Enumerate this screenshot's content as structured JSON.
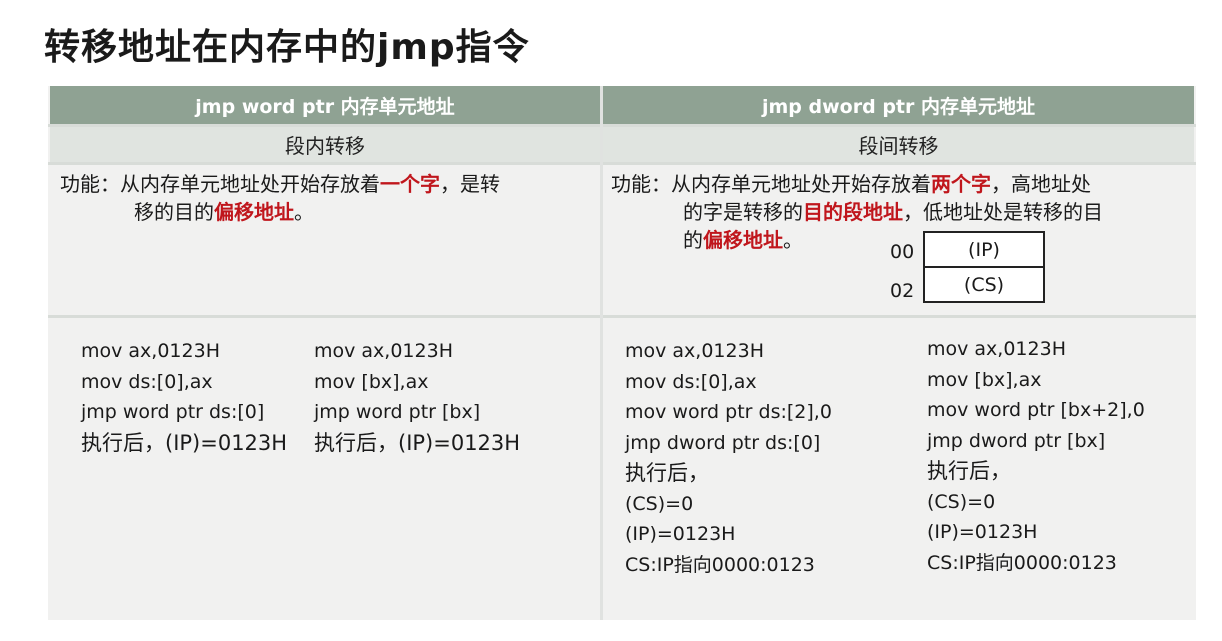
{
  "title": "转移地址在内存中的jmp指令",
  "columns": [
    {
      "header": "jmp word ptr 内存单元地址",
      "subheader": "段内转移",
      "desc_prefix": "功能：从内存单元地址处开始存放着",
      "desc_red1": "一个字",
      "desc_mid": "，是转",
      "desc_line2_a": "移的目的",
      "desc_red2": "偏移地址",
      "desc_line2_b": "。",
      "examples": [
        {
          "lines": [
            "mov ax,0123H",
            "mov ds:[0],ax",
            "jmp word ptr ds:[0]"
          ],
          "result": "执行后，(IP)=0123H"
        },
        {
          "lines": [
            "mov ax,0123H",
            "mov [bx],ax",
            "jmp word ptr [bx]"
          ],
          "result": "执行后，(IP)=0123H"
        }
      ]
    },
    {
      "header": "jmp dword ptr 内存单元地址",
      "subheader": "段间转移",
      "desc_prefix": "功能：从内存单元地址处开始存放着",
      "desc_red1": "两个字",
      "desc_mid": "，高地址处",
      "desc_line2_a": "的字是转移的",
      "desc_red2": "目的段地址",
      "desc_line2_b": "，低地址处是转移的目",
      "desc_line3_a": "的",
      "desc_red3": "偏移地址",
      "desc_line3_b": "。",
      "memory": [
        {
          "addr": "00",
          "value": "(IP)"
        },
        {
          "addr": "02",
          "value": "(CS)"
        }
      ],
      "examples": [
        {
          "lines": [
            "mov ax,0123H",
            "mov ds:[0],ax",
            "mov word ptr ds:[2],0",
            "jmp dword ptr ds:[0]"
          ],
          "result": "执行后，",
          "after": [
            "(CS)=0",
            "(IP)=0123H",
            "CS:IP指向0000:0123"
          ]
        },
        {
          "lines": [
            "mov ax,0123H",
            "mov [bx],ax",
            "mov word ptr [bx+2],0",
            "jmp dword ptr [bx]"
          ],
          "result": "执行后，",
          "after": [
            "(CS)=0",
            "(IP)=0123H",
            "CS:IP指向0000:0123"
          ]
        }
      ]
    }
  ]
}
